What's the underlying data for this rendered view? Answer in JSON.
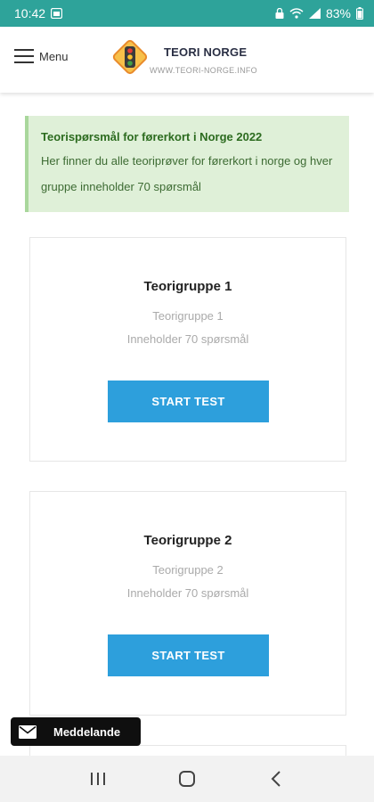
{
  "status_bar": {
    "time": "10:42",
    "battery": "83%"
  },
  "header": {
    "menu_label": "Menu",
    "brand_title": "TEORI NORGE",
    "brand_url": "WWW.TEORI-NORGE.INFO"
  },
  "info": {
    "title": "Teorispørsmål for førerkort i Norge 2022",
    "text": "Her finner du alle teoriprøver for førerkort i norge og hver gruppe inneholder 70 spørsmål"
  },
  "cards": [
    {
      "title": "Teorigruppe 1",
      "subtitle": "Teorigruppe 1",
      "description": "Inneholder 70 spørsmål",
      "button": "START TEST"
    },
    {
      "title": "Teorigruppe 2",
      "subtitle": "Teorigruppe 2",
      "description": "Inneholder 70 spørsmål",
      "button": "START TEST"
    }
  ],
  "messaging": {
    "label": "Meddelande",
    "icon": "envelope-icon"
  },
  "colors": {
    "status_bar": "#2ea39a",
    "info_bg": "#dff0d8",
    "button": "#2d9fdc"
  }
}
